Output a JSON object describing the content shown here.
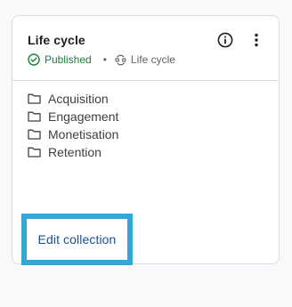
{
  "card": {
    "title": "Life cycle",
    "status": {
      "label": "Published",
      "icon": "check-circle-icon",
      "color": "#188038"
    },
    "separator": "•",
    "collection_type": {
      "label": "Life cycle",
      "icon": "lifecycle-icon"
    },
    "actions": {
      "info_icon": "info-icon",
      "more_icon": "more-vert-icon"
    },
    "folders": [
      {
        "label": "Acquisition",
        "icon": "folder-icon"
      },
      {
        "label": "Engagement",
        "icon": "folder-icon"
      },
      {
        "label": "Monetisation",
        "icon": "folder-icon"
      },
      {
        "label": "Retention",
        "icon": "folder-icon"
      }
    ],
    "edit_button": {
      "label": "Edit collection",
      "highlight_color": "#35a6d8"
    }
  }
}
